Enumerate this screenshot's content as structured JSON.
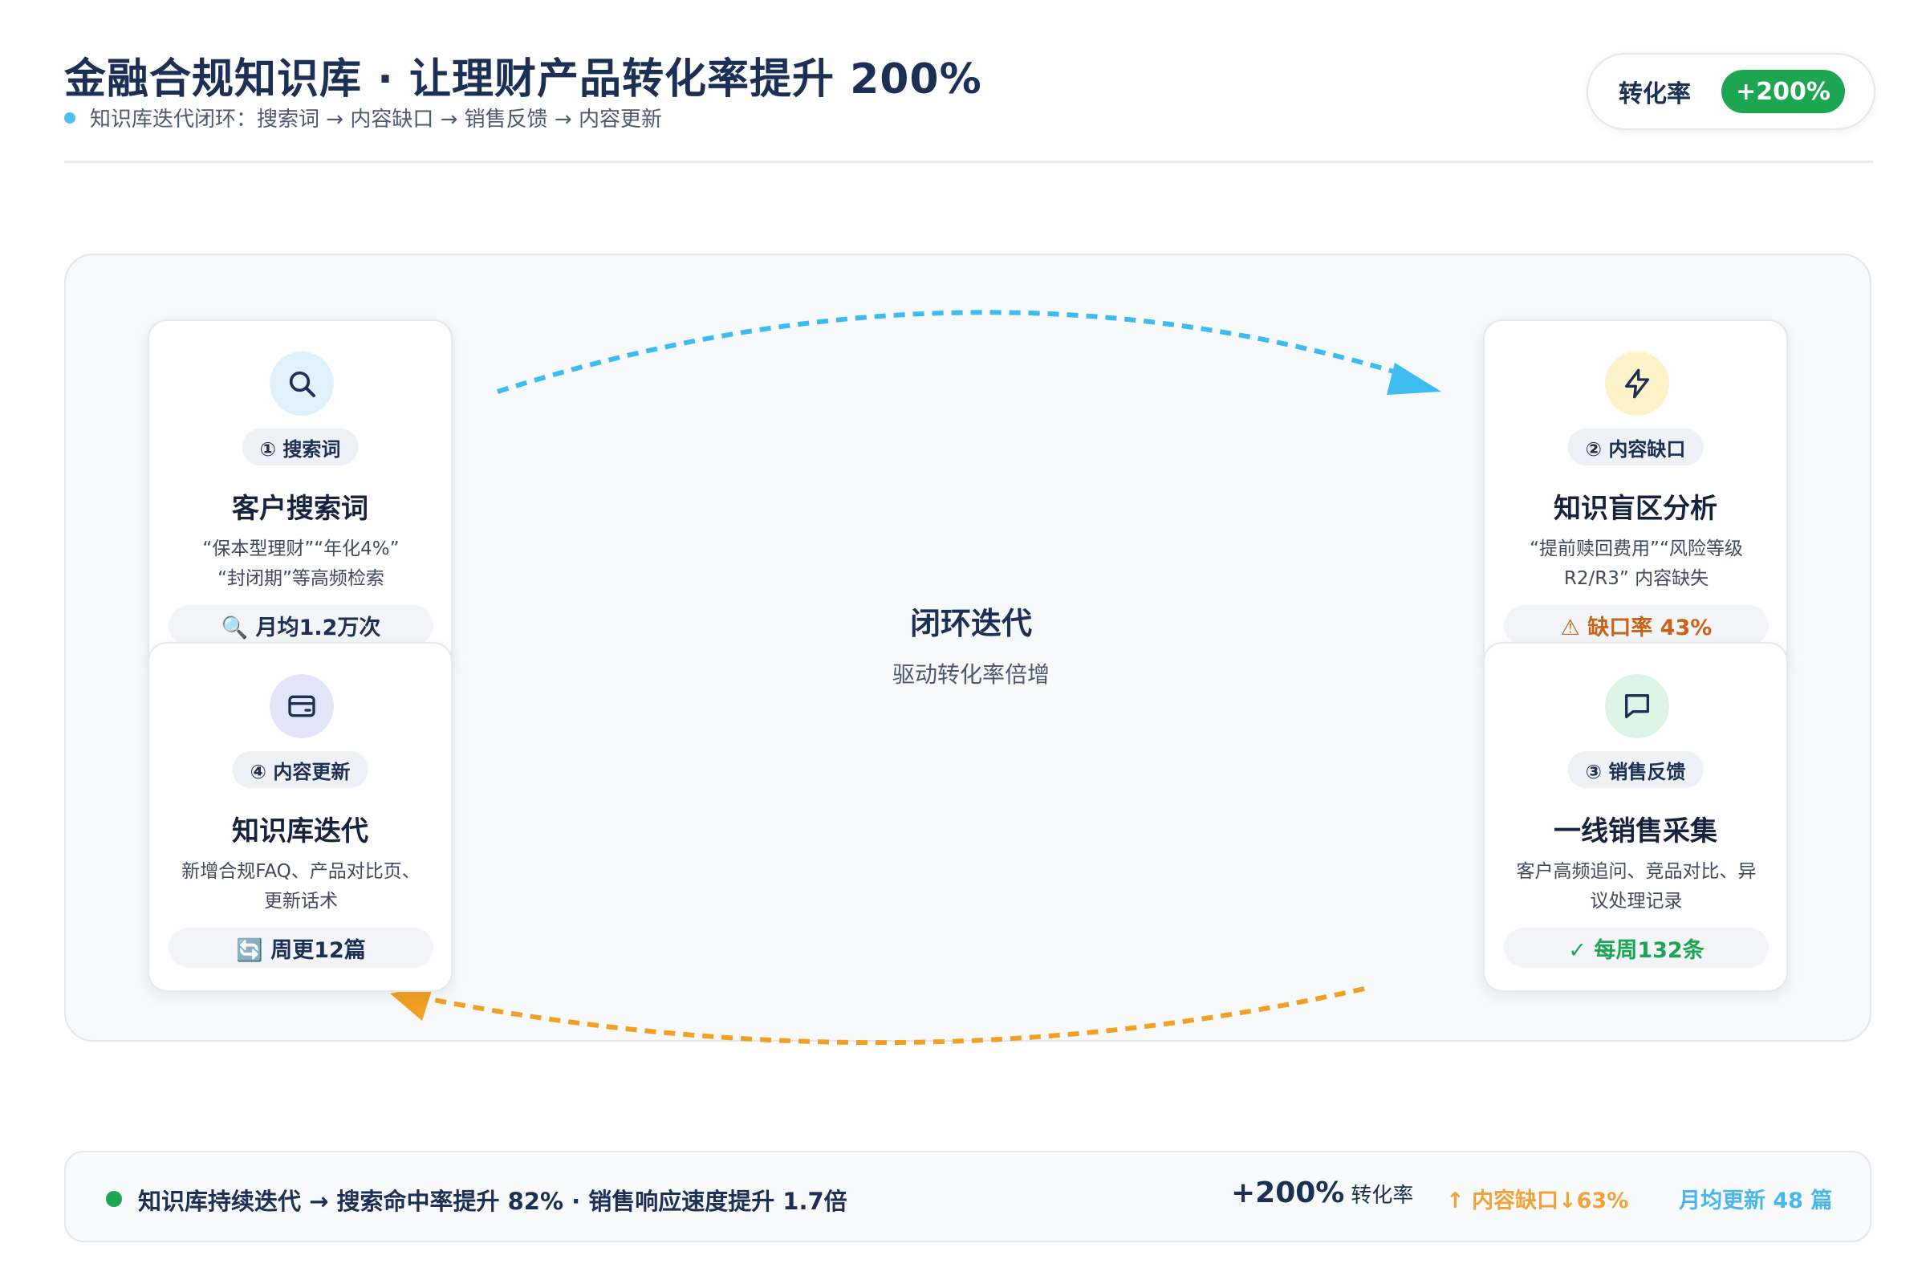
{
  "header": {
    "title": "金融合规知识库 · 让理财产品转化率提升 200%",
    "subtitle": "知识库迭代闭环：搜索词 → 内容缺口 → 销售反馈 → 内容更新",
    "metric_label": "转化率",
    "metric_value": "+200%"
  },
  "center": {
    "title": "闭环迭代",
    "subtitle": "驱动转化率倍增"
  },
  "cards": [
    {
      "step": "① 搜索词",
      "title": "客户搜索词",
      "desc_line1": "“保本型理财”“年化4%”",
      "desc_line2": "“封闭期”等高频检索",
      "badge": "🔍 月均1.2万次",
      "icon": "search-icon"
    },
    {
      "step": "② 内容缺口",
      "title": "知识盲区分析",
      "desc_line1": "“提前赎回费用”“风险等级",
      "desc_line2": "R2/R3” 内容缺失",
      "badge": "⚠ 缺口率 43%",
      "icon": "lightning-icon"
    },
    {
      "step": "③ 销售反馈",
      "title": "一线销售采集",
      "desc_line1": "客户高频追问、竞品对比、异",
      "desc_line2": "议处理记录",
      "badge": "✓ 每周132条",
      "icon": "chat-bubble-icon"
    },
    {
      "step": "④ 内容更新",
      "title": "知识库迭代",
      "desc_line1": "新增合规FAQ、产品对比页、",
      "desc_line2": "更新话术",
      "badge": "🔄 周更12篇",
      "icon": "wallet-icon"
    }
  ],
  "footer": {
    "summary": "知识库持续迭代 → 搜索命中率提升 82% · 销售响应速度提升 1.7倍",
    "conversion_value": "+200%",
    "conversion_label": "转化率",
    "gap_text": "↑ 内容缺口↓63%",
    "update_text": "月均更新 48 篇"
  },
  "colors": {
    "title": "#1c2f55",
    "accent_green": "#1ea552",
    "arrow_blue": "#3dbcf2",
    "arrow_orange": "#f2a023",
    "warn": "#c8631a"
  }
}
